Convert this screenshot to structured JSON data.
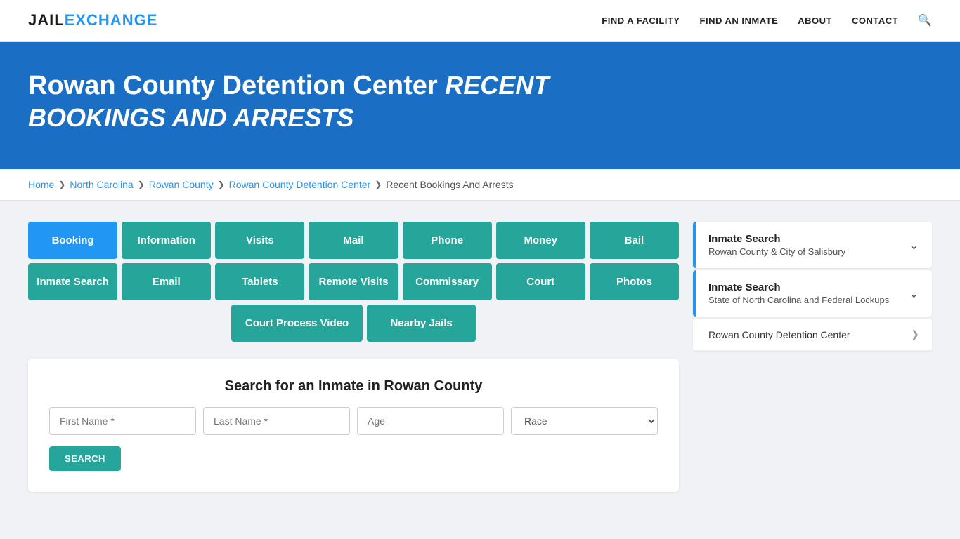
{
  "header": {
    "logo_jail": "JAIL",
    "logo_exchange": "EXCHANGE",
    "nav": [
      {
        "label": "FIND A FACILITY",
        "name": "find-facility"
      },
      {
        "label": "FIND AN INMATE",
        "name": "find-inmate"
      },
      {
        "label": "ABOUT",
        "name": "about"
      },
      {
        "label": "CONTACT",
        "name": "contact"
      }
    ]
  },
  "hero": {
    "title_main": "Rowan County Detention Center",
    "title_italic": "RECENT BOOKINGS AND ARRESTS"
  },
  "breadcrumb": {
    "items": [
      {
        "label": "Home",
        "name": "home"
      },
      {
        "label": "North Carolina",
        "name": "north-carolina"
      },
      {
        "label": "Rowan County",
        "name": "rowan-county"
      },
      {
        "label": "Rowan County Detention Center",
        "name": "rowan-county-detention-center"
      },
      {
        "label": "Recent Bookings And Arrests",
        "name": "recent-bookings",
        "current": true
      }
    ]
  },
  "tabs": {
    "row1": [
      {
        "label": "Booking",
        "active": true
      },
      {
        "label": "Information",
        "active": false
      },
      {
        "label": "Visits",
        "active": false
      },
      {
        "label": "Mail",
        "active": false
      },
      {
        "label": "Phone",
        "active": false
      },
      {
        "label": "Money",
        "active": false
      },
      {
        "label": "Bail",
        "active": false
      }
    ],
    "row2": [
      {
        "label": "Inmate Search",
        "active": false
      },
      {
        "label": "Email",
        "active": false
      },
      {
        "label": "Tablets",
        "active": false
      },
      {
        "label": "Remote Visits",
        "active": false
      },
      {
        "label": "Commissary",
        "active": false
      },
      {
        "label": "Court",
        "active": false
      },
      {
        "label": "Photos",
        "active": false
      }
    ],
    "row3": [
      {
        "label": "Court Process Video",
        "active": false
      },
      {
        "label": "Nearby Jails",
        "active": false
      }
    ]
  },
  "search": {
    "title": "Search for an Inmate in Rowan County",
    "first_name_placeholder": "First Name *",
    "last_name_placeholder": "Last Name *",
    "age_placeholder": "Age",
    "race_placeholder": "Race",
    "button_label": "SEARCH"
  },
  "sidebar": {
    "items": [
      {
        "title": "Inmate Search",
        "subtitle": "Rowan County & City of Salisbury",
        "has_chevron": true,
        "type": "expandable"
      },
      {
        "title": "Inmate Search",
        "subtitle": "State of North Carolina and Federal Lockups",
        "has_chevron": true,
        "type": "expandable"
      },
      {
        "title": "Rowan County Detention Center",
        "subtitle": "",
        "has_chevron": true,
        "type": "plain"
      }
    ]
  }
}
